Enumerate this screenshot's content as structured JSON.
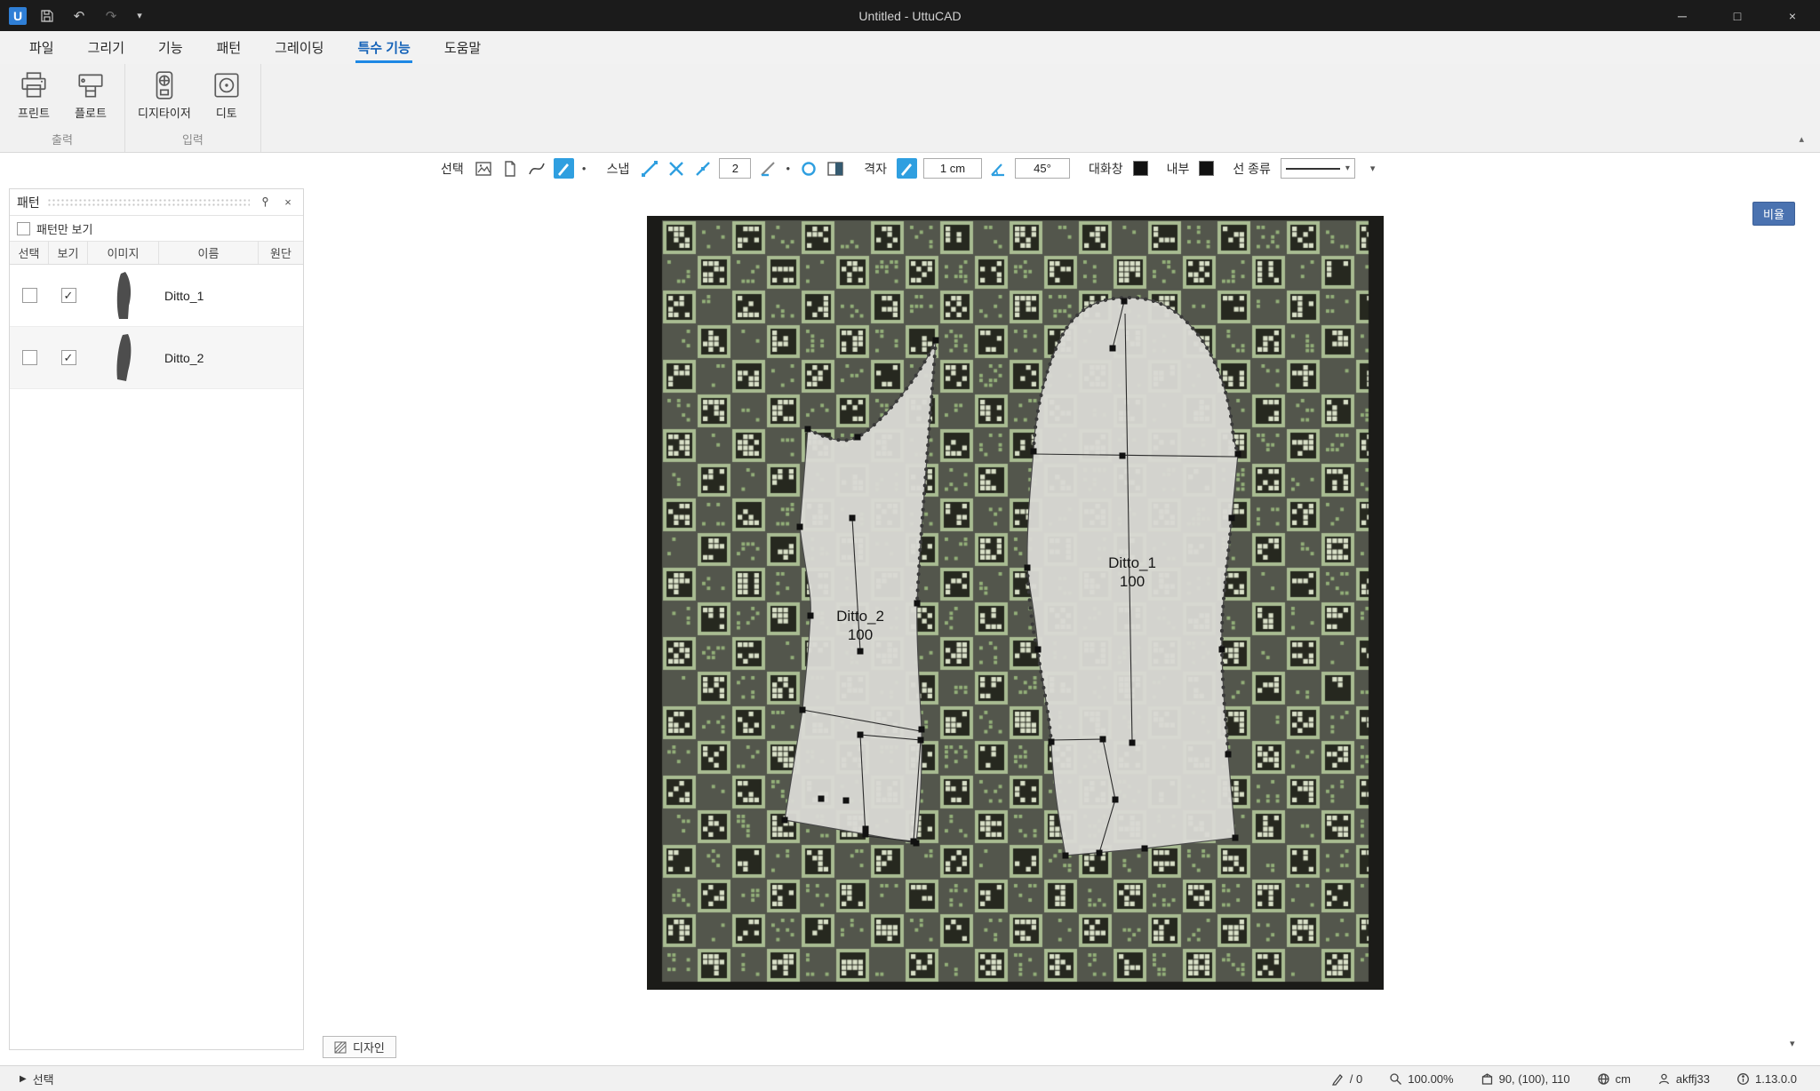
{
  "titlebar": {
    "title": "Untitled - UttuCAD",
    "logo_letter": "U"
  },
  "icons": {
    "undo": "↶",
    "redo": "↷",
    "caret_down": "▾",
    "minimize": "─",
    "maximize": "□",
    "close": "×",
    "check": "✓",
    "collapse": "▴",
    "overflow": "▾",
    "dot": "●",
    "select_arrow": "▶",
    "pin": "⊤"
  },
  "menu": {
    "items": [
      {
        "label": "파일"
      },
      {
        "label": "그리기"
      },
      {
        "label": "기능"
      },
      {
        "label": "패턴"
      },
      {
        "label": "그레이딩"
      },
      {
        "label": "특수 기능"
      },
      {
        "label": "도움말"
      }
    ]
  },
  "ribbon": {
    "groups": [
      {
        "label": "출력",
        "buttons": [
          {
            "label": "프린트"
          },
          {
            "label": "플로트"
          }
        ]
      },
      {
        "label": "입력",
        "buttons": [
          {
            "label": "디지타이저"
          },
          {
            "label": "디토"
          }
        ]
      }
    ]
  },
  "toolbar": {
    "select_label": "선택",
    "snap_label": "스냅",
    "snap_value": "2",
    "grid_label": "격자",
    "grid_value": "1 cm",
    "angle_value": "45°",
    "dialog_label": "대화창",
    "interior_label": "내부",
    "line_type_label": "선 종류"
  },
  "pattern_panel": {
    "title": "패턴",
    "filter_label": "패턴만 보기",
    "columns": [
      "선택",
      "보기",
      "이미지",
      "이름",
      "원단"
    ],
    "rows": [
      {
        "name": "Ditto_1",
        "visible_glyph": "✓"
      },
      {
        "name": "Ditto_2",
        "visible_glyph": "✓"
      }
    ]
  },
  "canvas": {
    "ratio_button": "비율",
    "design_tab": "디자인",
    "pieces": [
      {
        "name": "Ditto_1",
        "size": "100"
      },
      {
        "name": "Ditto_2",
        "size": "100"
      }
    ]
  },
  "status_bar": {
    "mode": "선택",
    "count": "/ 0",
    "zoom": "100.00%",
    "coords": "90, (100), 110",
    "unit": "cm",
    "user": "akffj33",
    "version": "1.13.0.0"
  },
  "photo_colors": {
    "base": "#53564c",
    "edge": "#1b1b18",
    "cell_light": "#a9bc92",
    "marker_dark": "#26281f",
    "marker_pixel": "#d9e0c8",
    "speckle": "#93af79",
    "piece_fill": "#d9d8d3",
    "piece_stroke": "#4a4a4a"
  },
  "accent": {
    "toolbar_blue": "#2f9fe0",
    "menu_underline": "#1e88e5",
    "ratio_button_blue": "#4a72b0"
  }
}
